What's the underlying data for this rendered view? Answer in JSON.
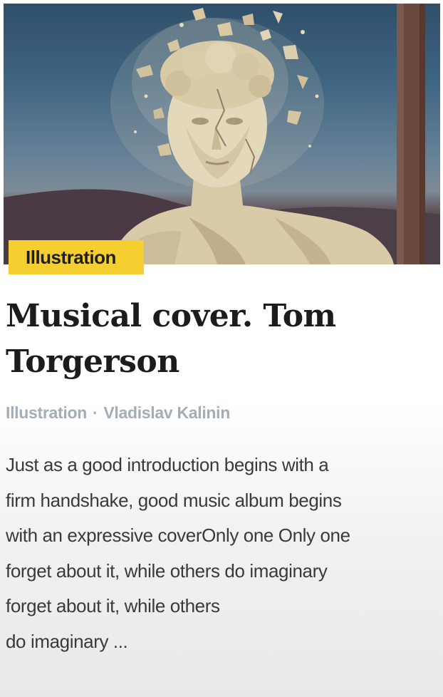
{
  "card": {
    "category_badge": "Illustration",
    "title_line1": "Musical cover. Tom",
    "title_line2": "Torgerson",
    "meta": {
      "category": "Illustration",
      "separator": "·",
      "author": "Vladislav Kalinin"
    },
    "excerpt": [
      "Just as a good introduction begins with a",
      "firm handshake, good music album begins",
      "with an expressive coverOnly one Only one",
      "forget about it, while others do imaginary",
      "forget about it, while others",
      "do imaginary ..."
    ]
  },
  "colors": {
    "badge_bg": "#f5ce2f",
    "title": "#1c1c1c",
    "meta": "#a3adb5",
    "body": "#3a3a3a"
  },
  "icons": {
    "hero_image": "shattering-marble-bust-illustration"
  }
}
